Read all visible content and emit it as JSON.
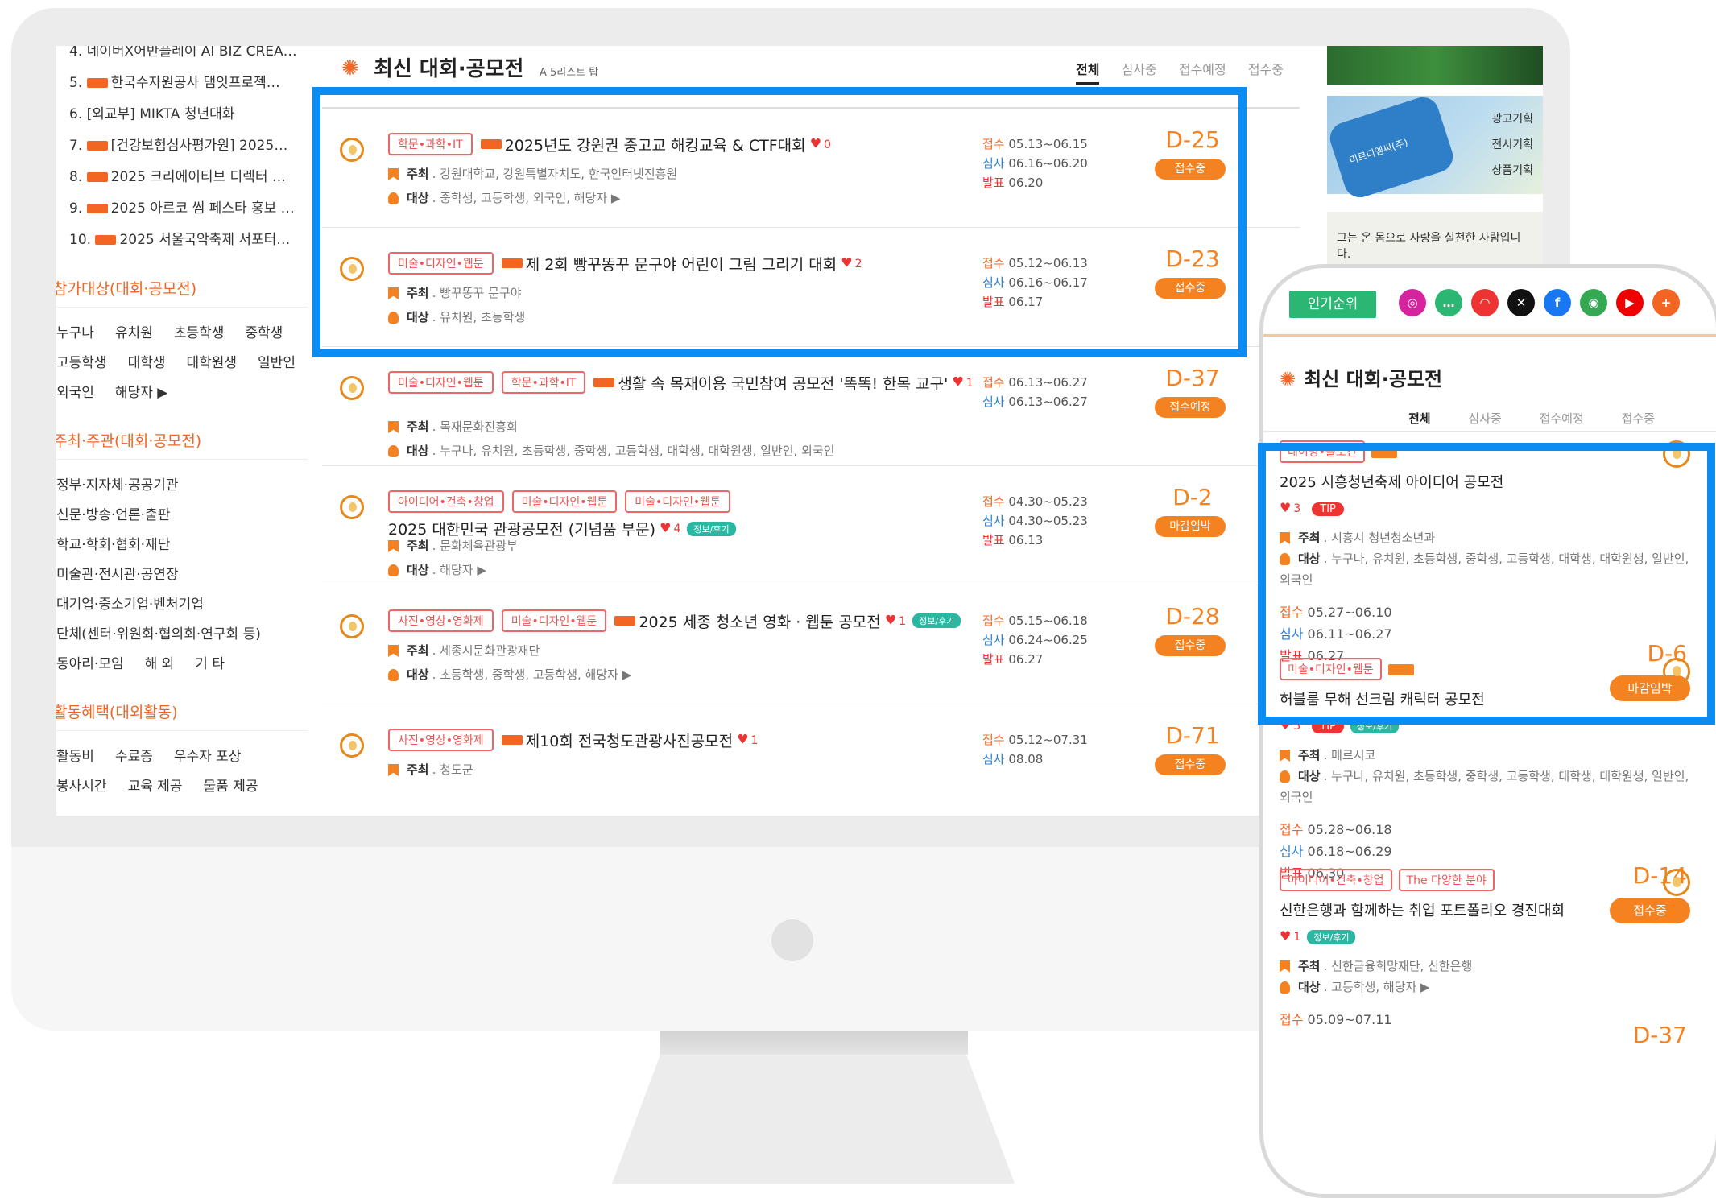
{
  "sidebar": {
    "ranking": [
      {
        "n": "4.",
        "text": "네이버X어반플레이 AI BIZ CREA…",
        "new": false
      },
      {
        "n": "5.",
        "text": "한국수자원공사 댐잇프로젝…",
        "new": true
      },
      {
        "n": "6.",
        "text": "[외교부] MIKTA 청년대화",
        "new": false
      },
      {
        "n": "7.",
        "text": "[건강보험심사평가원] 2025…",
        "new": true
      },
      {
        "n": "8.",
        "text": "2025 크리에이티브 디렉터 …",
        "new": true
      },
      {
        "n": "9.",
        "text": "2025 아르코 썸 페스타 홍보 …",
        "new": true
      },
      {
        "n": "10.",
        "text": "2025 서울국악축제 서포터…",
        "new": true
      }
    ],
    "target_title": "참가대상(대회·공모전)",
    "targets": [
      [
        "누구나",
        "유치원",
        "초등학생",
        "중학생"
      ],
      [
        "고등학생",
        "대학생",
        "대학원생",
        "일반인"
      ],
      [
        "외국인",
        "해당자 ▶"
      ]
    ],
    "host_title": "주최·주관(대회·공모전)",
    "hosts": [
      [
        "정부·지자체·공공기관"
      ],
      [
        "신문·방송·언론·출판"
      ],
      [
        "학교·학회·협회·재단"
      ],
      [
        "미술관·전시관·공연장"
      ],
      [
        "대기업·중소기업·벤처기업"
      ],
      [
        "단체(센터·위원회·협의회·연구회 등)"
      ],
      [
        "동아리·모임",
        "해 외",
        "기 타"
      ]
    ],
    "benefit_title": "활동혜택(대외활동)",
    "benefits": [
      [
        "활동비",
        "수료증",
        "우수자 포상"
      ],
      [
        "봉사시간",
        "교육 제공",
        "물품 제공"
      ]
    ]
  },
  "main": {
    "title": "최신 대회·공모전",
    "subtitle": "A 5리스트 탑",
    "tabs": [
      "전체",
      "심사중",
      "접수예정",
      "접수중"
    ],
    "items": [
      {
        "cats": [
          "학문•과학•IT"
        ],
        "new": true,
        "title": "2025년도 강원권 중고교 해킹교육 & CTF대회",
        "likes": "0",
        "info": false,
        "host": "강원대학교, 강원특별자치도, 한국인터넷진흥원",
        "target": "중학생, 고등학생, 외국인, 해당자 ▶",
        "d1": "05.13~06.15",
        "d2": "06.16~06.20",
        "d3": "06.20",
        "dday": "D-25",
        "status": "접수중"
      },
      {
        "cats": [
          "미술•디자인•웹툰"
        ],
        "new": true,
        "title": "제 2회 빵꾸똥꾸 문구야 어린이 그림 그리기 대회",
        "likes": "2",
        "info": false,
        "host": "빵꾸똥꾸 문구야",
        "target": "유치원, 초등학생",
        "d1": "05.12~06.13",
        "d2": "06.16~06.17",
        "d3": "06.17",
        "dday": "D-23",
        "status": "접수중"
      },
      {
        "cats": [
          "미술•디자인•웹툰",
          "학문•과학•IT"
        ],
        "new": true,
        "title": "생활 속 목재이용 국민참여 공모전 '똑똑! 한목 교구'",
        "likes": "1",
        "info": false,
        "host": "목재문화진흥회",
        "target": "누구나, 유치원, 초등학생, 중학생, 고등학생, 대학생, 대학원생, 일반인, 외국인",
        "d1": "06.13~06.27",
        "d2": "06.13~06.27",
        "d3": "",
        "dday": "D-37",
        "status": "접수예정"
      },
      {
        "cats": [
          "아이디어•건축•창업",
          "미술•디자인•웹툰",
          "미술•디자인•웹툰"
        ],
        "new": false,
        "title": "2025 대한민국 관광공모전 (기념품 부문)",
        "likes": "4",
        "info": true,
        "host": "문화체육관광부",
        "target": "해당자 ▶",
        "d1": "04.30~05.23",
        "d2": "04.30~05.23",
        "d3": "06.13",
        "dday": "D-2",
        "status": "마감임박"
      },
      {
        "cats": [
          "사진•영상•영화제",
          "미술•디자인•웹툰"
        ],
        "new": true,
        "title": "2025 세종 청소년 영화 · 웹툰 공모전",
        "likes": "1",
        "info": true,
        "host": "세종시문화관광재단",
        "target": "초등학생, 중학생, 고등학생, 해당자 ▶",
        "d1": "05.15~06.18",
        "d2": "06.24~06.25",
        "d3": "06.27",
        "dday": "D-28",
        "status": "접수중"
      },
      {
        "cats": [
          "사진•영상•영화제"
        ],
        "new": true,
        "title": "제10회 전국청도관광사진공모전",
        "likes": "1",
        "info": false,
        "host": "청도군",
        "target": "",
        "d1": "05.12~07.31",
        "d2": "08.08",
        "d3": "",
        "dday": "D-71",
        "status": "접수중"
      }
    ],
    "labels": {
      "host": "주최",
      "target": "대상",
      "d1": "접수",
      "d2": "심사",
      "d3": "발표",
      "info": "정보/후기",
      "new": "NEW"
    }
  },
  "right": {
    "banner2": [
      "광고기획",
      "전시기획",
      "상품기획"
    ],
    "banner2_company": "미르디엠씨(주)",
    "banner3": "그는 온 몸으로 사랑을 실천한 사람입니다."
  },
  "phone": {
    "rank_label": "인기순위",
    "socials": [
      {
        "name": "instagram-icon",
        "color": "#d6249f"
      },
      {
        "name": "chat-icon",
        "color": "#2bb673"
      },
      {
        "name": "talk-icon",
        "color": "#e33"
      },
      {
        "name": "x-icon",
        "color": "#111"
      },
      {
        "name": "facebook-icon",
        "color": "#1877f2"
      },
      {
        "name": "chrome-icon",
        "color": "#34a853"
      },
      {
        "name": "youtube-icon",
        "color": "#e00"
      },
      {
        "name": "plus-icon",
        "color": "#f26522"
      }
    ],
    "title": "최신 대회·공모전",
    "tabs": [
      "전체",
      "심사중",
      "접수예정",
      "접수중"
    ],
    "cards": [
      {
        "cats": [
          "네이밍•슬로건"
        ],
        "new": true,
        "title": "2025 시흥청년축제 아이디어 공모전",
        "likes": "3",
        "tip": true,
        "info": false,
        "host": "시흥시 청년청소년과",
        "target": "누구나, 유치원, 초등학생, 중학생, 고등학생, 대학생, 대학원생, 일반인, 외국인",
        "d1": "05.27~06.10",
        "d2": "06.11~06.27",
        "d3": "06.27",
        "dday": "D-6",
        "status": "마감임박"
      },
      {
        "cats": [
          "미술•디자인•웹툰"
        ],
        "new": true,
        "title": "허블룸 무해 선크림 캐릭터 공모전",
        "likes": "5",
        "tip": true,
        "info": true,
        "host": "메르시코",
        "target": "누구나, 유치원, 초등학생, 중학생, 고등학생, 대학생, 대학원생, 일반인, 외국인",
        "d1": "05.28~06.18",
        "d2": "06.18~06.29",
        "d3": "06.30",
        "dday": "D-14",
        "status": "접수중"
      },
      {
        "cats": [
          "아이디어•건축•창업",
          "The 다양한 분야"
        ],
        "new": false,
        "title": "신한은행과 함께하는 취업 포트폴리오 경진대회",
        "likes": "1",
        "tip": false,
        "info": true,
        "host": "신한금융희망재단, 신한은행",
        "target": "고등학생, 해당자 ▶",
        "d1": "05.09~07.11",
        "d2": "",
        "d3": "",
        "dday": "D-37",
        "status": ""
      }
    ],
    "labels": {
      "tip": "TIP",
      "info": "정보/후기"
    }
  }
}
